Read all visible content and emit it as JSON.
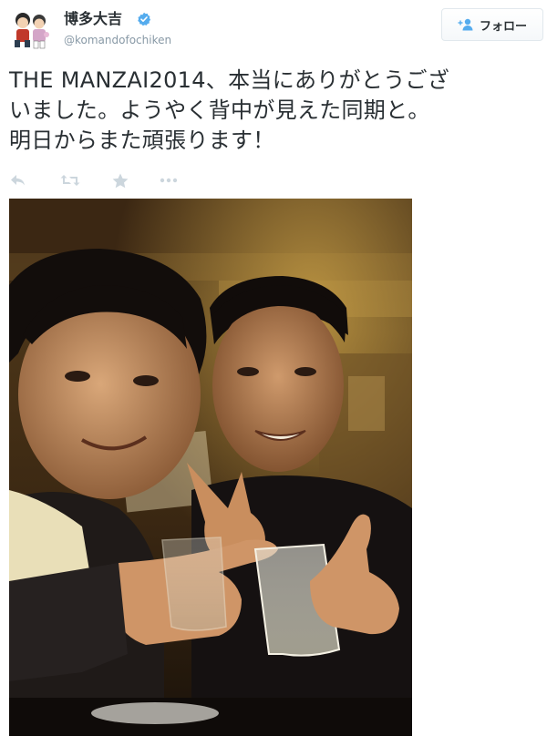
{
  "user": {
    "display_name": "博多大吉",
    "screen_name": "@komandofochiken",
    "avatar_icon": "avatar-illustration-icon",
    "verified_icon": "verified-badge-icon"
  },
  "follow_button": {
    "label": "フォロー",
    "icon": "add-user-icon"
  },
  "tweet": {
    "lines": [
      "THE MANZAI2014、本当にありがとうござ",
      "いました。ようやく背中が見えた同期と。",
      "明日からまた頑張ります！"
    ]
  },
  "actions": [
    {
      "name": "reply",
      "icon": "reply-icon"
    },
    {
      "name": "retweet",
      "icon": "retweet-icon"
    },
    {
      "name": "favorite",
      "icon": "star-icon"
    },
    {
      "name": "more",
      "icon": "more-dots-icon"
    }
  ],
  "colors": {
    "text": "#292f33",
    "muted": "#8899a6",
    "verified": "#55acee",
    "action_icon": "#ccd6dd"
  }
}
